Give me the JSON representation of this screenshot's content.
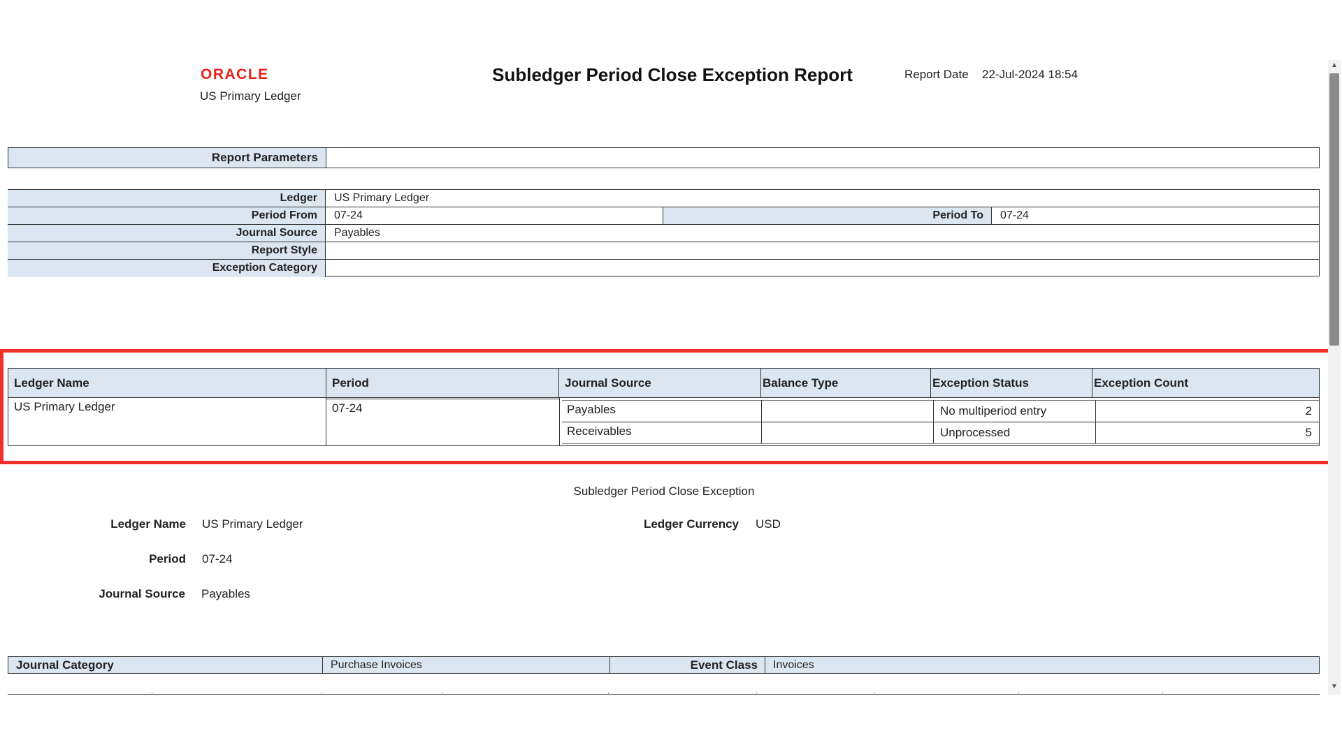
{
  "header": {
    "logo_text": "ORACLE",
    "ledger": "US Primary Ledger",
    "title": "Subledger Period Close Exception Report",
    "report_date_label": "Report Date",
    "report_date_value": "22-Jul-2024 18:54"
  },
  "report_parameters": {
    "heading": "Report Parameters",
    "ledger_label": "Ledger",
    "ledger_value": "US Primary Ledger",
    "period_from_label": "Period From",
    "period_from_value": "07-24",
    "period_to_label": "Period To",
    "period_to_value": "07-24",
    "journal_source_label": "Journal Source",
    "journal_source_value": "Payables",
    "report_style_label": "Report Style",
    "report_style_value": "",
    "exception_category_label": "Exception Category",
    "exception_category_value": ""
  },
  "summary_table": {
    "columns": [
      "Ledger Name",
      "Period",
      "Journal Source",
      "Balance Type",
      "Exception Status",
      "Exception Count"
    ],
    "ledger_name": "US Primary Ledger",
    "period": "07-24",
    "rows": [
      {
        "journal_source": "Payables",
        "balance_type": "",
        "exception_status": "No multiperiod entry",
        "exception_count": "2"
      },
      {
        "journal_source": "Receivables",
        "balance_type": "",
        "exception_status": "Unprocessed",
        "exception_count": "5"
      }
    ]
  },
  "detail": {
    "section_title": "Subledger Period Close Exception",
    "ledger_name_label": "Ledger Name",
    "ledger_name_value": "US Primary Ledger",
    "ledger_currency_label": "Ledger Currency",
    "ledger_currency_value": "USD",
    "period_label": "Period",
    "period_value": "07-24",
    "journal_source_label": "Journal Source",
    "journal_source_value": "Payables",
    "journal_category_label": "Journal Category",
    "journal_category_value": "Purchase Invoices",
    "event_class_label": "Event Class",
    "event_class_value": "Invoices"
  },
  "colors": {
    "label_background": "#dce6f1",
    "highlight_border": "#f2302b",
    "logo": "#e8211c"
  }
}
